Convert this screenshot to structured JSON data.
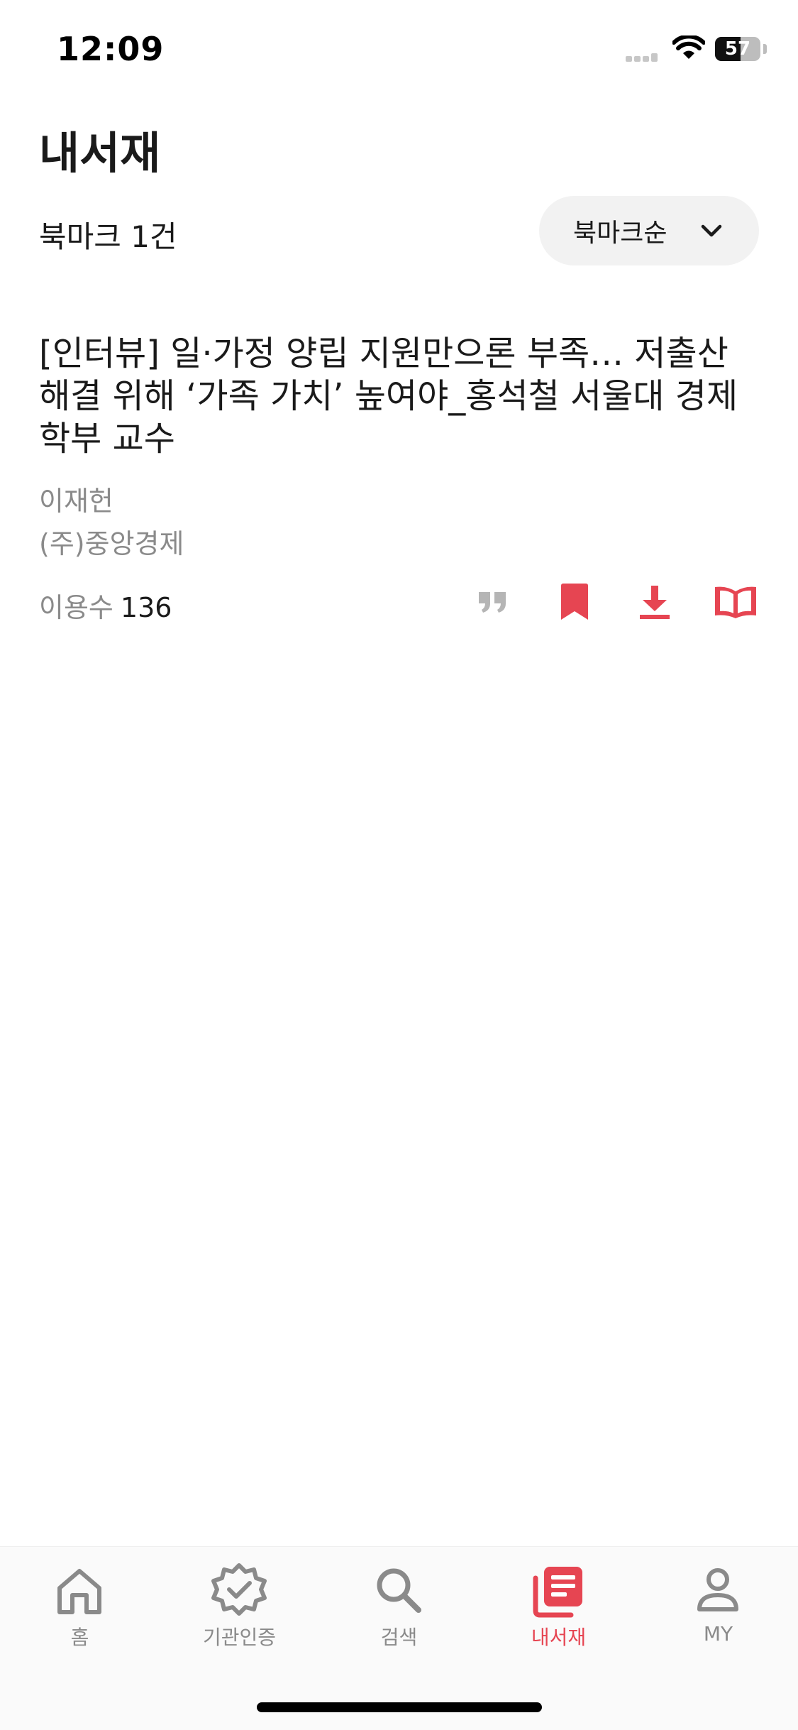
{
  "status_bar": {
    "time": "12:09",
    "battery_pct": "57",
    "battery_level": 0.57
  },
  "header": {
    "title": "내서재"
  },
  "toolbar": {
    "bookmark_count": "북마크 1건",
    "sort_label": "북마크순"
  },
  "item": {
    "title": "[인터뷰] 일·가정 양립 지원만으론 부족… 저출산 해결 위해 ‘가족 가치’ 높여야_홍석철 서울대 경제학부 교수",
    "author": "이재헌",
    "publisher": "(주)중앙경제",
    "usage_label": "이용수",
    "usage_value": "136",
    "actions": [
      "quote-icon",
      "bookmark-icon",
      "download-icon",
      "open-book-icon"
    ]
  },
  "tabs": [
    {
      "label": "홈",
      "icon": "home-icon",
      "active": false
    },
    {
      "label": "기관인증",
      "icon": "verified-badge-icon",
      "active": false
    },
    {
      "label": "검색",
      "icon": "search-icon",
      "active": false
    },
    {
      "label": "내서재",
      "icon": "library-icon",
      "active": true
    },
    {
      "label": "MY",
      "icon": "person-icon",
      "active": false
    }
  ],
  "colors": {
    "accent": "#e64552",
    "muted": "#8a8a8a",
    "text": "#1a1a1a",
    "pill_bg": "#f2f2f2"
  }
}
